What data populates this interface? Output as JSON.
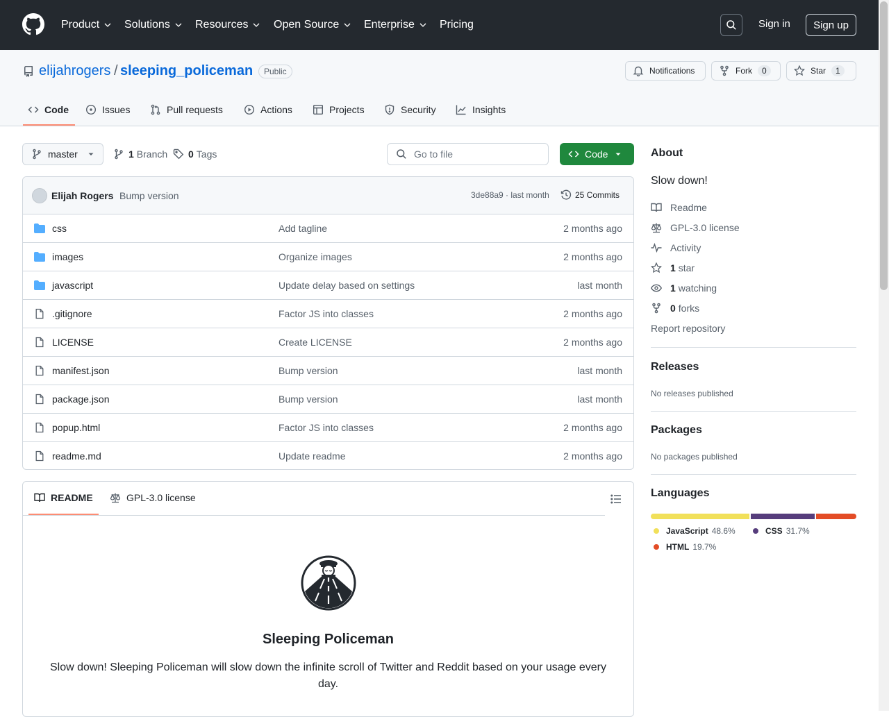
{
  "nav": {
    "items": [
      "Product",
      "Solutions",
      "Resources",
      "Open Source",
      "Enterprise",
      "Pricing"
    ],
    "signin": "Sign in",
    "signup": "Sign up"
  },
  "repo": {
    "owner": "elijahrogers",
    "slash": "/",
    "name": "sleeping_policeman",
    "visibility": "Public",
    "notifications_label": "Notifications",
    "fork_label": "Fork",
    "fork_count": "0",
    "star_label": "Star",
    "star_count": "1"
  },
  "tabs": [
    "Code",
    "Issues",
    "Pull requests",
    "Actions",
    "Projects",
    "Security",
    "Insights"
  ],
  "toolbar": {
    "branch": "master",
    "branch_count": "1",
    "branch_label": "Branch",
    "tag_count": "0",
    "tag_label": "Tags",
    "goto_placeholder": "Go to file",
    "code_label": "Code"
  },
  "commit": {
    "author": "Elijah Rogers",
    "message": "Bump version",
    "sha_time": "3de88a9 · last month",
    "commits_label": "25 Commits"
  },
  "files": [
    {
      "name": "css",
      "type": "dir",
      "message": "Add tagline",
      "date": "2 months ago"
    },
    {
      "name": "images",
      "type": "dir",
      "message": "Organize images",
      "date": "2 months ago"
    },
    {
      "name": "javascript",
      "type": "dir",
      "message": "Update delay based on settings",
      "date": "last month"
    },
    {
      "name": ".gitignore",
      "type": "file",
      "message": "Factor JS into classes",
      "date": "2 months ago"
    },
    {
      "name": "LICENSE",
      "type": "file",
      "message": "Create LICENSE",
      "date": "2 months ago"
    },
    {
      "name": "manifest.json",
      "type": "file",
      "message": "Bump version",
      "date": "last month"
    },
    {
      "name": "package.json",
      "type": "file",
      "message": "Bump version",
      "date": "last month"
    },
    {
      "name": "popup.html",
      "type": "file",
      "message": "Factor JS into classes",
      "date": "2 months ago"
    },
    {
      "name": "readme.md",
      "type": "file",
      "message": "Update readme",
      "date": "2 months ago"
    }
  ],
  "readme": {
    "tab_readme": "README",
    "tab_license": "GPL-3.0 license",
    "title": "Sleeping Policeman",
    "description": "Slow down! Sleeping Policeman will slow down the infinite scroll of Twitter and Reddit based on your usage every day."
  },
  "about": {
    "heading": "About",
    "description": "Slow down!",
    "readme": "Readme",
    "license": "GPL-3.0 license",
    "activity": "Activity",
    "stars_count": "1",
    "stars_label": "star",
    "watching_count": "1",
    "watching_label": "watching",
    "forks_count": "0",
    "forks_label": "forks",
    "report": "Report repository"
  },
  "releases": {
    "heading": "Releases",
    "text": "No releases published"
  },
  "packages": {
    "heading": "Packages",
    "text": "No packages published"
  },
  "languages": {
    "heading": "Languages",
    "items": [
      {
        "name": "JavaScript",
        "percent": "48.6%",
        "value": 48.6,
        "color": "#f1e05a"
      },
      {
        "name": "CSS",
        "percent": "31.7%",
        "value": 31.7,
        "color": "#563d7c"
      },
      {
        "name": "HTML",
        "percent": "19.7%",
        "value": 19.7,
        "color": "#e34c26"
      }
    ]
  },
  "icons": [
    "github-logo-icon",
    "chevron-down-icon",
    "search-icon",
    "repo-icon",
    "bell-icon",
    "fork-icon",
    "star-icon",
    "code-icon",
    "issue-icon",
    "pull-request-icon",
    "play-icon",
    "table-icon",
    "shield-icon",
    "graph-icon",
    "branch-icon",
    "tag-icon",
    "history-icon",
    "folder-icon",
    "file-icon",
    "book-icon",
    "law-icon",
    "pulse-icon",
    "eye-icon",
    "list-icon",
    "triangle-down-icon"
  ]
}
